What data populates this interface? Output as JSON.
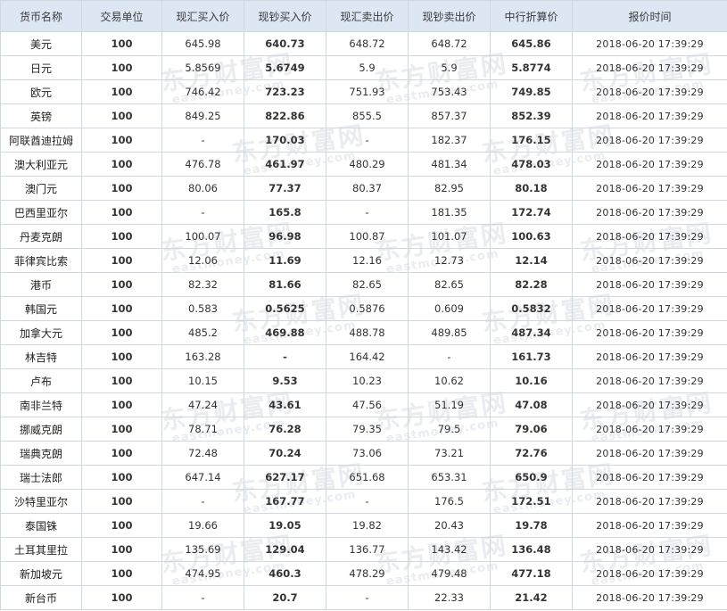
{
  "table": {
    "headers": [
      "货币名称",
      "交易单位",
      "现汇买入价",
      "现钞买入价",
      "现汇卖出价",
      "现钞卖出价",
      "中行折算价",
      "报价时间"
    ],
    "rows": [
      [
        "美元",
        "100",
        "645.98",
        "640.73",
        "648.72",
        "648.72",
        "645.86",
        "2018-06-20 17:39:29"
      ],
      [
        "日元",
        "100",
        "5.8569",
        "5.6749",
        "5.9",
        "5.9",
        "5.8774",
        "2018-06-20 17:39:29"
      ],
      [
        "欧元",
        "100",
        "746.42",
        "723.23",
        "751.93",
        "753.43",
        "749.85",
        "2018-06-20 17:39:29"
      ],
      [
        "英镑",
        "100",
        "849.25",
        "822.86",
        "855.5",
        "857.37",
        "852.39",
        "2018-06-20 17:39:29"
      ],
      [
        "阿联酋迪拉姆",
        "100",
        "-",
        "170.03",
        "-",
        "182.37",
        "176.15",
        "2018-06-20 17:39:29"
      ],
      [
        "澳大利亚元",
        "100",
        "476.78",
        "461.97",
        "480.29",
        "481.34",
        "478.03",
        "2018-06-20 17:39:29"
      ],
      [
        "澳门元",
        "100",
        "80.06",
        "77.37",
        "80.37",
        "82.95",
        "80.18",
        "2018-06-20 17:39:29"
      ],
      [
        "巴西里亚尔",
        "100",
        "-",
        "165.8",
        "-",
        "181.35",
        "172.74",
        "2018-06-20 17:39:29"
      ],
      [
        "丹麦克朗",
        "100",
        "100.07",
        "96.98",
        "100.87",
        "101.07",
        "100.63",
        "2018-06-20 17:39:29"
      ],
      [
        "菲律宾比索",
        "100",
        "12.06",
        "11.69",
        "12.16",
        "12.73",
        "12.14",
        "2018-06-20 17:39:29"
      ],
      [
        "港币",
        "100",
        "82.32",
        "81.66",
        "82.65",
        "82.65",
        "82.28",
        "2018-06-20 17:39:29"
      ],
      [
        "韩国元",
        "100",
        "0.583",
        "0.5625",
        "0.5876",
        "0.609",
        "0.5832",
        "2018-06-20 17:39:29"
      ],
      [
        "加拿大元",
        "100",
        "485.2",
        "469.88",
        "488.78",
        "489.85",
        "487.34",
        "2018-06-20 17:39:29"
      ],
      [
        "林吉特",
        "100",
        "163.28",
        "-",
        "164.42",
        "-",
        "161.73",
        "2018-06-20 17:39:29"
      ],
      [
        "卢布",
        "100",
        "10.15",
        "9.53",
        "10.23",
        "10.62",
        "10.16",
        "2018-06-20 17:39:29"
      ],
      [
        "南非兰特",
        "100",
        "47.24",
        "43.61",
        "47.56",
        "51.19",
        "47.08",
        "2018-06-20 17:39:29"
      ],
      [
        "挪威克朗",
        "100",
        "78.71",
        "76.28",
        "79.35",
        "79.5",
        "79.06",
        "2018-06-20 17:39:29"
      ],
      [
        "瑞典克朗",
        "100",
        "72.48",
        "70.24",
        "73.06",
        "73.21",
        "72.76",
        "2018-06-20 17:39:29"
      ],
      [
        "瑞士法郎",
        "100",
        "647.14",
        "627.17",
        "651.68",
        "653.31",
        "650.9",
        "2018-06-20 17:39:29"
      ],
      [
        "沙特里亚尔",
        "100",
        "-",
        "167.77",
        "-",
        "176.5",
        "172.51",
        "2018-06-20 17:39:29"
      ],
      [
        "泰国铢",
        "100",
        "19.66",
        "19.05",
        "19.82",
        "20.43",
        "19.78",
        "2018-06-20 17:39:29"
      ],
      [
        "土耳其里拉",
        "100",
        "135.69",
        "129.04",
        "136.77",
        "143.42",
        "136.48",
        "2018-06-20 17:39:29"
      ],
      [
        "新加坡元",
        "100",
        "474.95",
        "460.3",
        "478.29",
        "479.48",
        "477.18",
        "2018-06-20 17:39:29"
      ],
      [
        "新台币",
        "100",
        "-",
        "20.7",
        "-",
        "22.33",
        "21.42",
        "2018-06-20 17:39:29"
      ]
    ]
  },
  "watermark": {
    "text": "东方财富网",
    "sub": "eastmoney.com"
  }
}
